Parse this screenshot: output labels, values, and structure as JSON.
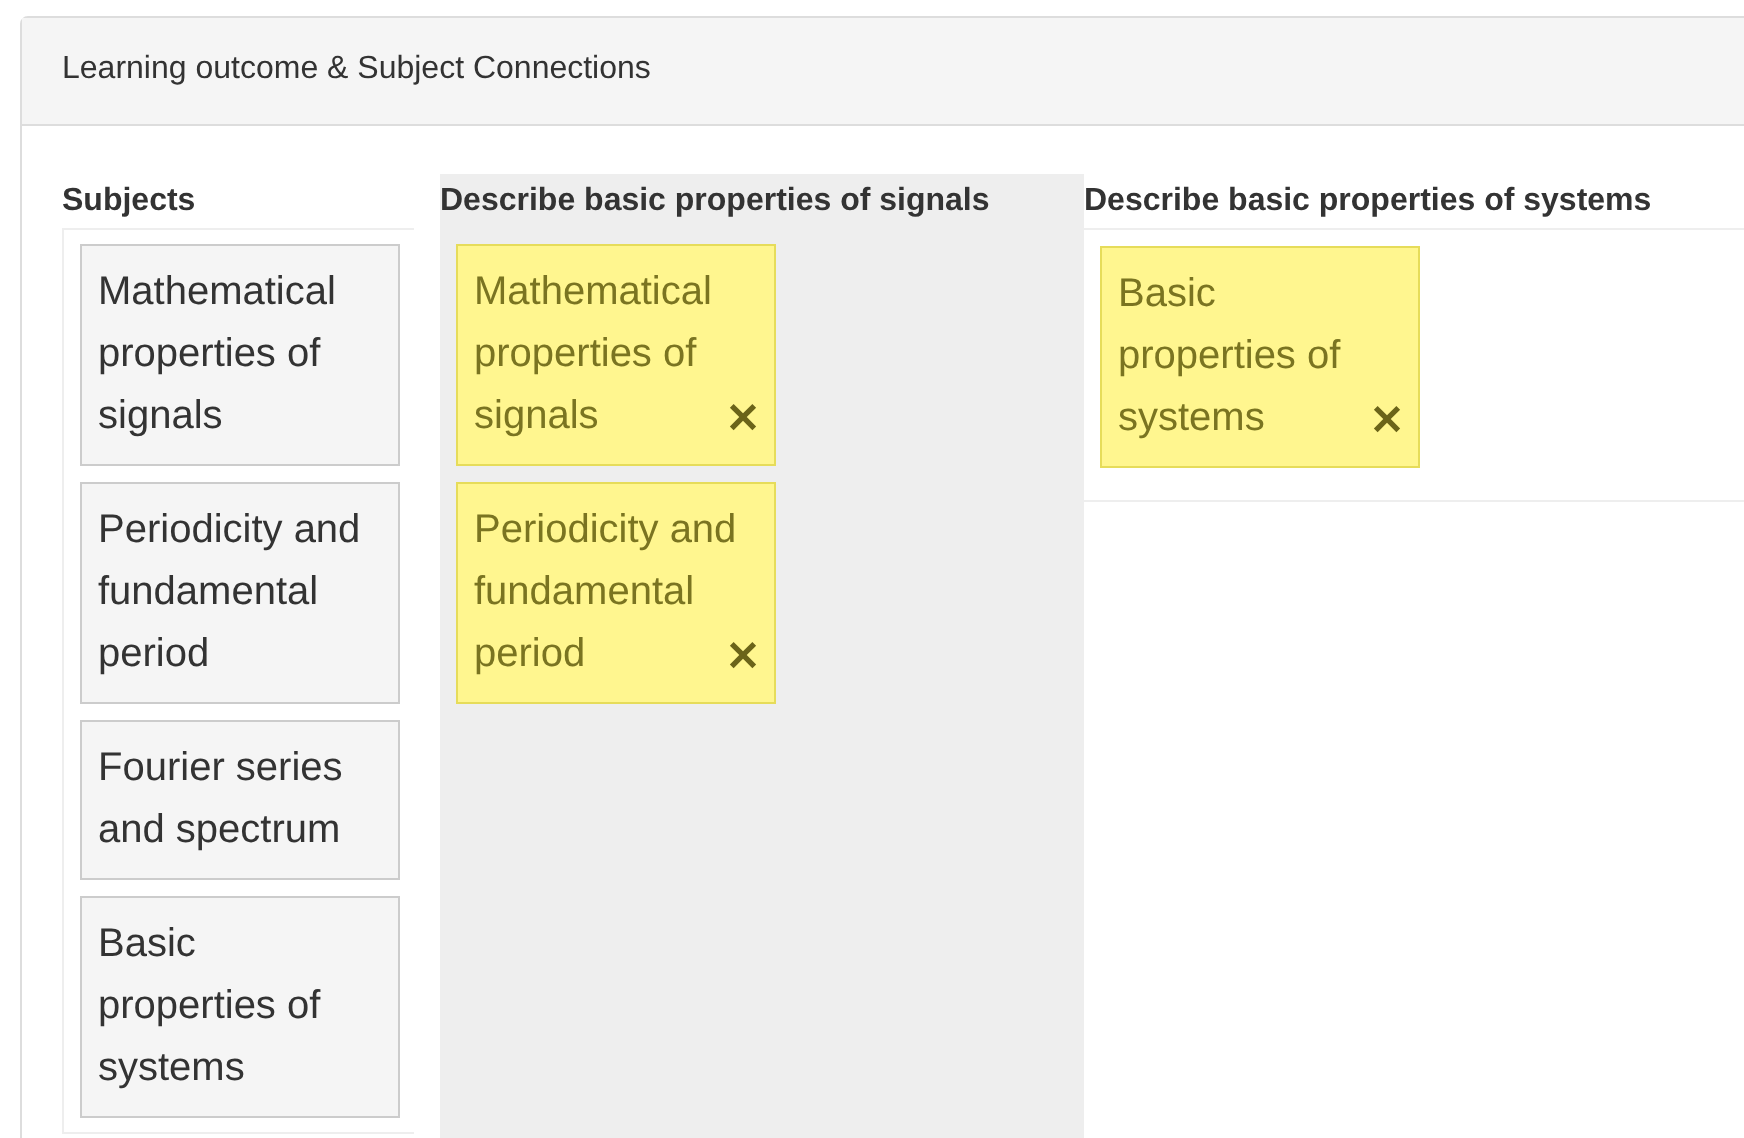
{
  "panel": {
    "title": "Learning outcome & Subject Connections"
  },
  "subjects": {
    "heading": "Subjects",
    "items": [
      {
        "label": "Mathematical properties of signals"
      },
      {
        "label": "Periodicity and fundamental period"
      },
      {
        "label": "Fourier series and spectrum"
      },
      {
        "label": "Basic properties of systems"
      }
    ]
  },
  "outcomes": [
    {
      "heading": "Describe basic properties of signals",
      "highlighted": true,
      "items": [
        {
          "label": "Mathematical properties of signals"
        },
        {
          "label": "Periodicity and fundamental period"
        }
      ]
    },
    {
      "heading": "Describe basic properties of systems",
      "highlighted": false,
      "items": [
        {
          "label": "Basic properties of systems"
        }
      ]
    }
  ]
}
